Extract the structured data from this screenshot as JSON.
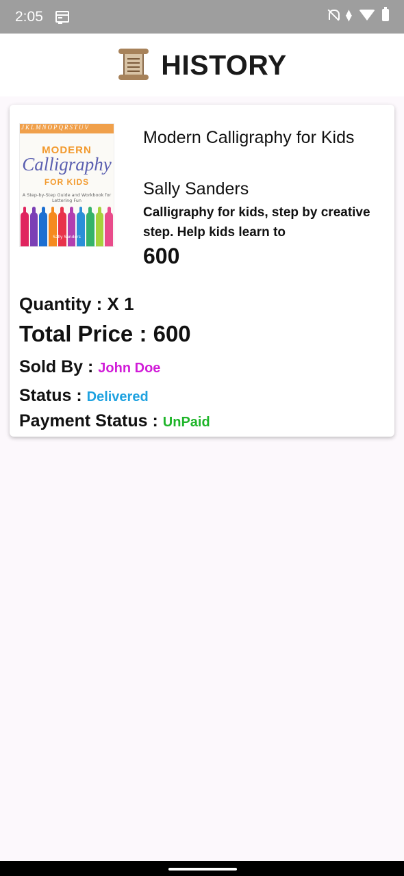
{
  "status_bar": {
    "time": "2:05",
    "network_badge": "4"
  },
  "header": {
    "title": "HISTORY",
    "icon": "scroll-icon"
  },
  "order": {
    "cover": {
      "top_strip": "JKLMNOPQRSTUV",
      "line1": "MODERN",
      "line2": "Calligraphy",
      "line3": "FOR KIDS",
      "subtitle": "A Step-by-Step Guide and Workbook for Lettering Fun",
      "author": "Sally Sanders",
      "marker_colors": [
        "#e0245e",
        "#7b3fb5",
        "#1c6fd1",
        "#f58a1f",
        "#e8324a",
        "#b23fb0",
        "#2a8fd8",
        "#35b36a",
        "#a6d33c",
        "#e94c8b"
      ]
    },
    "title": "Modern Calligraphy for Kids",
    "author": "Sally Sanders",
    "description": "Calligraphy for kids, step by creative step. Help kids learn to",
    "price": "600",
    "quantity_label": "Quantity : X 1",
    "total_label": "Total Price : 600",
    "sold_by_label": "Sold By : ",
    "sold_by_value": "John Doe",
    "status_label": "Status : ",
    "status_value": "Delivered",
    "payment_label": "Payment Status : ",
    "payment_value": "UnPaid"
  },
  "colors": {
    "seller": "#d11dd8",
    "status": "#1fa2e0",
    "payment": "#1fb52a",
    "status_bar_bg": "#9e9e9e",
    "page_bg": "#fcf8fc"
  }
}
